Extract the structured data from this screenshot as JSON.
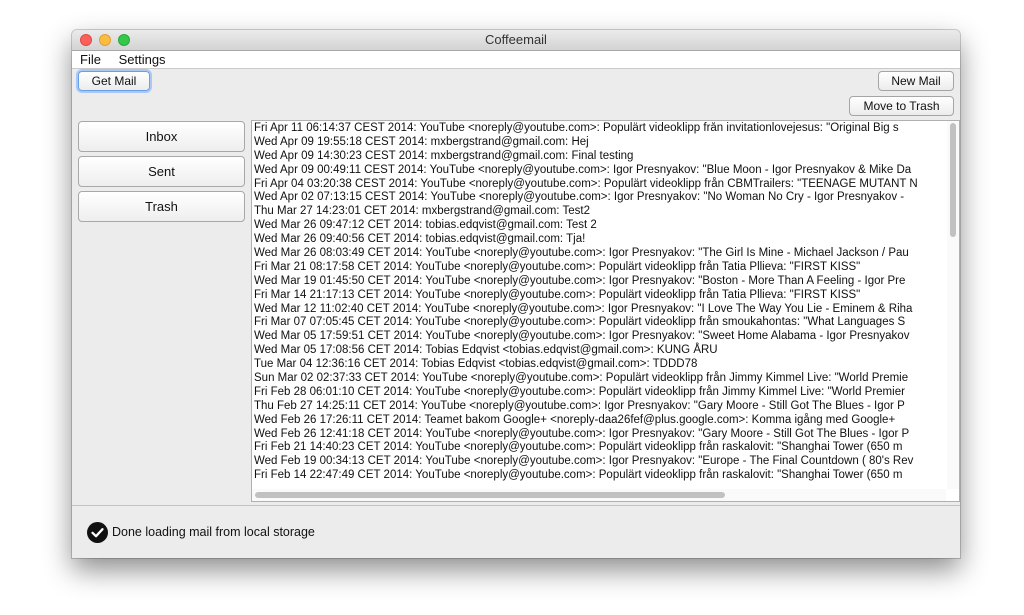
{
  "window": {
    "title": "Coffeemail"
  },
  "menu": {
    "file": "File",
    "settings": "Settings"
  },
  "toolbar": {
    "get_mail": "Get Mail",
    "new_mail": "New Mail",
    "move_to_trash": "Move to Trash"
  },
  "sidebar": {
    "inbox": "Inbox",
    "sent": "Sent",
    "trash": "Trash"
  },
  "mails": [
    "Fri Apr 11 06:14:37 CEST 2014: YouTube <noreply@youtube.com>: Populärt videoklipp från invitationlovejesus: \"Original Big s",
    "Wed Apr 09 19:55:18 CEST 2014: mxbergstrand@gmail.com: Hej",
    "Wed Apr 09 14:30:23 CEST 2014: mxbergstrand@gmail.com: Final testing",
    "Wed Apr 09 00:49:11 CEST 2014: YouTube <noreply@youtube.com>: Igor Presnyakov: \"Blue Moon - Igor Presnyakov & Mike Da",
    "Fri Apr 04 03:20:38 CEST 2014: YouTube <noreply@youtube.com>: Populärt videoklipp från CBMTrailers: \"TEENAGE MUTANT N",
    "Wed Apr 02 07:13:15 CEST 2014: YouTube <noreply@youtube.com>: Igor Presnyakov: \"No Woman No Cry - Igor Presnyakov -",
    "Thu Mar 27 14:23:01 CET 2014: mxbergstrand@gmail.com: Test2",
    "Wed Mar 26 09:47:12 CET 2014: tobias.edqvist@gmail.com: Test 2",
    "Wed Mar 26 09:40:56 CET 2014: tobias.edqvist@gmail.com: Tja!",
    "Wed Mar 26 08:03:49 CET 2014: YouTube <noreply@youtube.com>: Igor Presnyakov: \"The Girl Is Mine - Michael Jackson / Pau",
    "Fri Mar 21 08:17:58 CET 2014: YouTube <noreply@youtube.com>: Populärt videoklipp från Tatia Pllieva: \"FIRST KISS\"",
    "Wed Mar 19 01:45:50 CET 2014: YouTube <noreply@youtube.com>: Igor Presnyakov: \"Boston - More Than A Feeling - Igor Pre",
    "Fri Mar 14 21:17:13 CET 2014: YouTube <noreply@youtube.com>: Populärt videoklipp från Tatia Pllieva: \"FIRST KISS\"",
    "Wed Mar 12 11:02:40 CET 2014: YouTube <noreply@youtube.com>: Igor Presnyakov: \"I Love The Way You Lie - Eminem & Riha",
    "Fri Mar 07 07:05:45 CET 2014: YouTube <noreply@youtube.com>: Populärt videoklipp från smoukahontas: \"What Languages S",
    "Wed Mar 05 17:59:51 CET 2014: YouTube <noreply@youtube.com>: Igor Presnyakov: \"Sweet Home Alabama - Igor Presnyakov",
    "Wed Mar 05 17:08:56 CET 2014: Tobias Edqvist <tobias.edqvist@gmail.com>: KUNG ÅRU",
    "Tue Mar 04 12:36:16 CET 2014: Tobias Edqvist <tobias.edqvist@gmail.com>: TDDD78",
    "Sun Mar 02 02:37:33 CET 2014: YouTube <noreply@youtube.com>: Populärt videoklipp från Jimmy Kimmel Live: \"World Premie",
    "Fri Feb 28 06:01:10 CET 2014: YouTube <noreply@youtube.com>: Populärt videoklipp från Jimmy Kimmel Live: \"World Premier",
    "Thu Feb 27 14:25:11 CET 2014: YouTube <noreply@youtube.com>: Igor Presnyakov: \"Gary Moore - Still Got The Blues - Igor P",
    "Wed Feb 26 17:26:11 CET 2014: Teamet bakom Google+ <noreply-daa26fef@plus.google.com>: Komma igång med Google+",
    "Wed Feb 26 12:41:18 CET 2014: YouTube <noreply@youtube.com>: Igor Presnyakov: \"Gary Moore - Still Got The Blues - Igor P",
    "Fri Feb 21 14:40:23 CET 2014: YouTube <noreply@youtube.com>: Populärt videoklipp från raskalovit: \"Shanghai Tower (650 m",
    "Wed Feb 19 00:34:13 CET 2014: YouTube <noreply@youtube.com>: Igor Presnyakov: \"Europe - The Final Countdown ( 80's Rev",
    "Fri Feb 14 22:47:49 CET 2014: YouTube <noreply@youtube.com>: Populärt videoklipp från raskalovit: \"Shanghai Tower (650 m"
  ],
  "status": {
    "text": "Done loading mail from local storage",
    "icon": "check-circle-icon"
  },
  "colors": {
    "close": "#fc605b",
    "minimize": "#fdbc40",
    "maximize": "#34c84a",
    "focus_ring": "#6b9ee6"
  }
}
